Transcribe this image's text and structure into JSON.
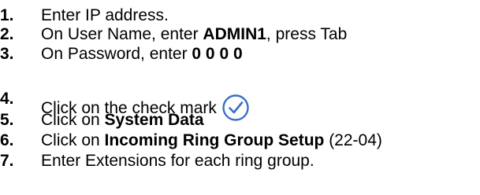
{
  "steps": [
    {
      "number": "1.",
      "text": "Enter IP address."
    },
    {
      "number": "2.",
      "pre": "On User Name, enter ",
      "bold": "ADMIN1",
      "post": ", press Tab"
    },
    {
      "number": "3.",
      "pre": "On Password, enter ",
      "bold": "0 0 0 0"
    },
    {
      "number": "4.",
      "text": "Click on the check mark",
      "icon": "check-mark-icon"
    },
    {
      "number": "5.",
      "pre": "Click on ",
      "bold": "System Data"
    },
    {
      "number": "6.",
      "pre": "Click on ",
      "bold": "Incoming Ring Group Setup",
      "post": " (22-04)"
    },
    {
      "number": "7.",
      "text": "Enter Extensions for each ring group."
    }
  ],
  "colors": {
    "text": "#000000",
    "check_icon_stroke": "#3a6fc4",
    "check_icon_fill": "#ffffff"
  }
}
